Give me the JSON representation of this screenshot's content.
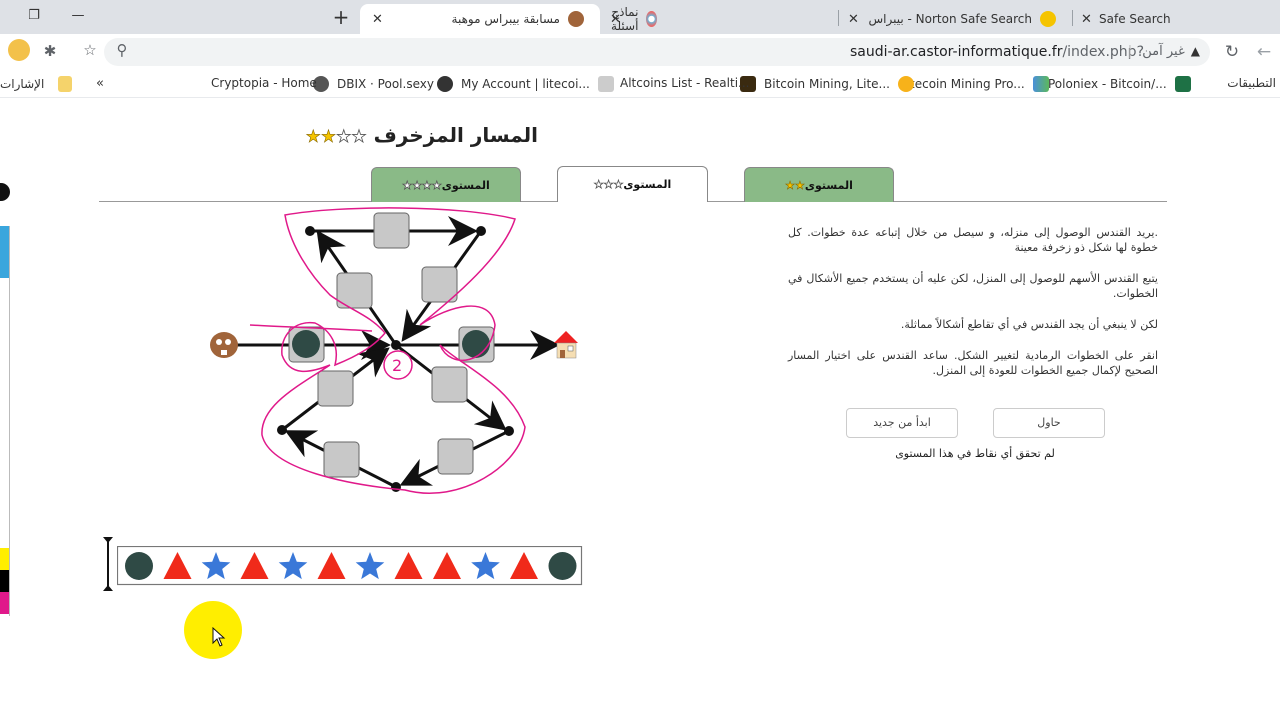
{
  "browser": {
    "tabs": [
      {
        "title": "مسابقة بيبراس موهبة",
        "active": true,
        "favicon": "beaver-icon"
      },
      {
        "title": "نماذج أسئلة",
        "active": false,
        "favicon": "globe-swirl-icon"
      },
      {
        "title": "Norton Safe Search - بيبراس",
        "active": false,
        "favicon": "norton-check-icon"
      },
      {
        "title": "Safe Search",
        "active": false,
        "favicon": ""
      }
    ],
    "new_tab_symbol": "+",
    "close_symbol": "✕",
    "url_host": "saudi-ar.castor-informatique.fr",
    "url_path": "/index.php?",
    "security_label": "غير آمن",
    "bookmarks": [
      {
        "label": "التطبيقات",
        "icon": "apps-icon"
      },
      {
        "label": "Poloniex - Bitcoin/...",
        "icon": "excel-icon"
      },
      {
        "label": "Litecoin Mining Pro...",
        "icon": "chart-icon"
      },
      {
        "label": "Bitcoin Mining, Lite...",
        "icon": "bitcoin-icon"
      },
      {
        "label": "Altcoins List - Realti...",
        "icon": "mining-rig-icon"
      },
      {
        "label": "My Account | litecoi...",
        "icon": "coins-icon"
      },
      {
        "label": "DBIX · Pool.sexy",
        "icon": "globe-icon"
      },
      {
        "label": "Cryptopia - Home",
        "icon": "network-icon"
      }
    ],
    "overflow_symbol": "«",
    "other_bookmarks_label": "الإشارات الأ"
  },
  "task": {
    "title": "المسار المزخرف",
    "title_stars": {
      "filled": 2,
      "total": 4
    },
    "level_tabs": [
      {
        "label": "المستوى",
        "stars_filled": 2,
        "stars_total": 2,
        "active": false
      },
      {
        "label": "المستوى",
        "stars_filled": 0,
        "stars_total": 3,
        "active": true
      },
      {
        "label": "المستوى",
        "stars_filled": 0,
        "stars_total": 4,
        "active": false
      }
    ],
    "description": [
      ".يريد القندس الوصول إلى منزله، و سيصل من خلال إتباعه عدة خطوات. كل خطوة لها شكل ذو زخرفة معينة",
      "يتبع القندس الأسهم للوصول إلى المنزل، لكن عليه أن يستخدم جميع الأشكال في الخطوات.",
      "لكن لا ينبغي أن يجد القندس في أي تقاطع أشكالاً مماثلة.",
      "انقر على الخطوات الرمادية لتغيير الشكل. ساعد القندس على اختيار المسار الصحيح لإكمال جميع الخطوات للعودة إلى المنزل."
    ],
    "buttons": {
      "try": "حاول",
      "restart": "ابدأ من جديد"
    },
    "status": "لم تحقق أي نقاط في هذا المستوى",
    "annotation_number": "2",
    "sequence": [
      "circle",
      "triangle",
      "star",
      "triangle",
      "star",
      "triangle",
      "star",
      "triangle",
      "triangle",
      "star",
      "triangle",
      "circle"
    ],
    "colors": {
      "circle": "#2f4a45",
      "triangle": "#f02a1a",
      "star": "#3a78d8",
      "tab_green": "#8aba87",
      "annotation": "#e0198a",
      "step_box": "#c8c8c8"
    }
  }
}
